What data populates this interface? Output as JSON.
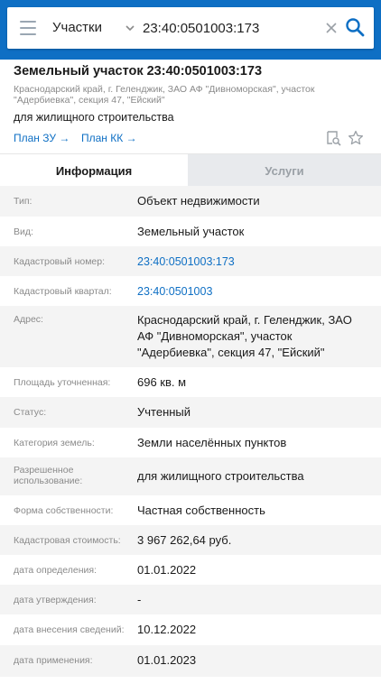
{
  "search": {
    "category": "Участки",
    "query": "23:40:0501003:173"
  },
  "card": {
    "title": "Земельный участок 23:40:0501003:173",
    "address_line1": "Краснодарский край, г. Геленджик, ЗАО АФ \"Дивноморская\", участок",
    "address_line2": "\"Адербиевка\", секция 47, \"Ейский\"",
    "purpose": "для жилищного строительства",
    "link_zu": "План ЗУ →",
    "link_kk": "План КК →"
  },
  "tabs": {
    "info": "Информация",
    "services": "Услуги"
  },
  "rows": [
    {
      "label": "Тип:",
      "value": "Объект недвижимости"
    },
    {
      "label": "Вид:",
      "value": "Земельный участок"
    },
    {
      "label": "Кадастровый номер:",
      "value": "23:40:0501003:173"
    },
    {
      "label": "Кадастровый квартал:",
      "value": "23:40:0501003"
    },
    {
      "label": "Адрес:",
      "value_line1": "Краснодарский край, г. Геленджик, ЗАО",
      "value_line2": "АФ \"Дивноморская\", участок",
      "value_line3": "\"Адербиевка\", секция 47, \"Ейский\""
    },
    {
      "label": "Площадь уточненная:",
      "value": "696 кв. м"
    },
    {
      "label": "Статус:",
      "value": "Учтенный"
    },
    {
      "label": "Категория земель:",
      "value": "Земли населённых пунктов"
    },
    {
      "label_line1": "Разрешенное",
      "label_line2": "использование:",
      "value": "для жилищного строительства"
    },
    {
      "label": "Форма собственности:",
      "value": "Частная собственность"
    },
    {
      "label": "Кадастровая стоимость:",
      "value": "3 967 262,64 руб."
    },
    {
      "label": "дата определения:",
      "value": "01.01.2022"
    },
    {
      "label": "дата утверждения:",
      "value": "-"
    },
    {
      "label": "дата внесения сведений:",
      "value": "10.12.2022"
    },
    {
      "label": "дата применения:",
      "value": "01.01.2023"
    }
  ],
  "colors": {
    "brand_blue": "#0e6fc4",
    "label_gray": "#8a8a8a",
    "alt_row": "#f4f4f4",
    "tab_inactive": "#e8eaed"
  },
  "icons": [
    "menu-icon",
    "chevron-down-icon",
    "clear-icon",
    "search-icon",
    "map-search-icon",
    "star-icon"
  ]
}
